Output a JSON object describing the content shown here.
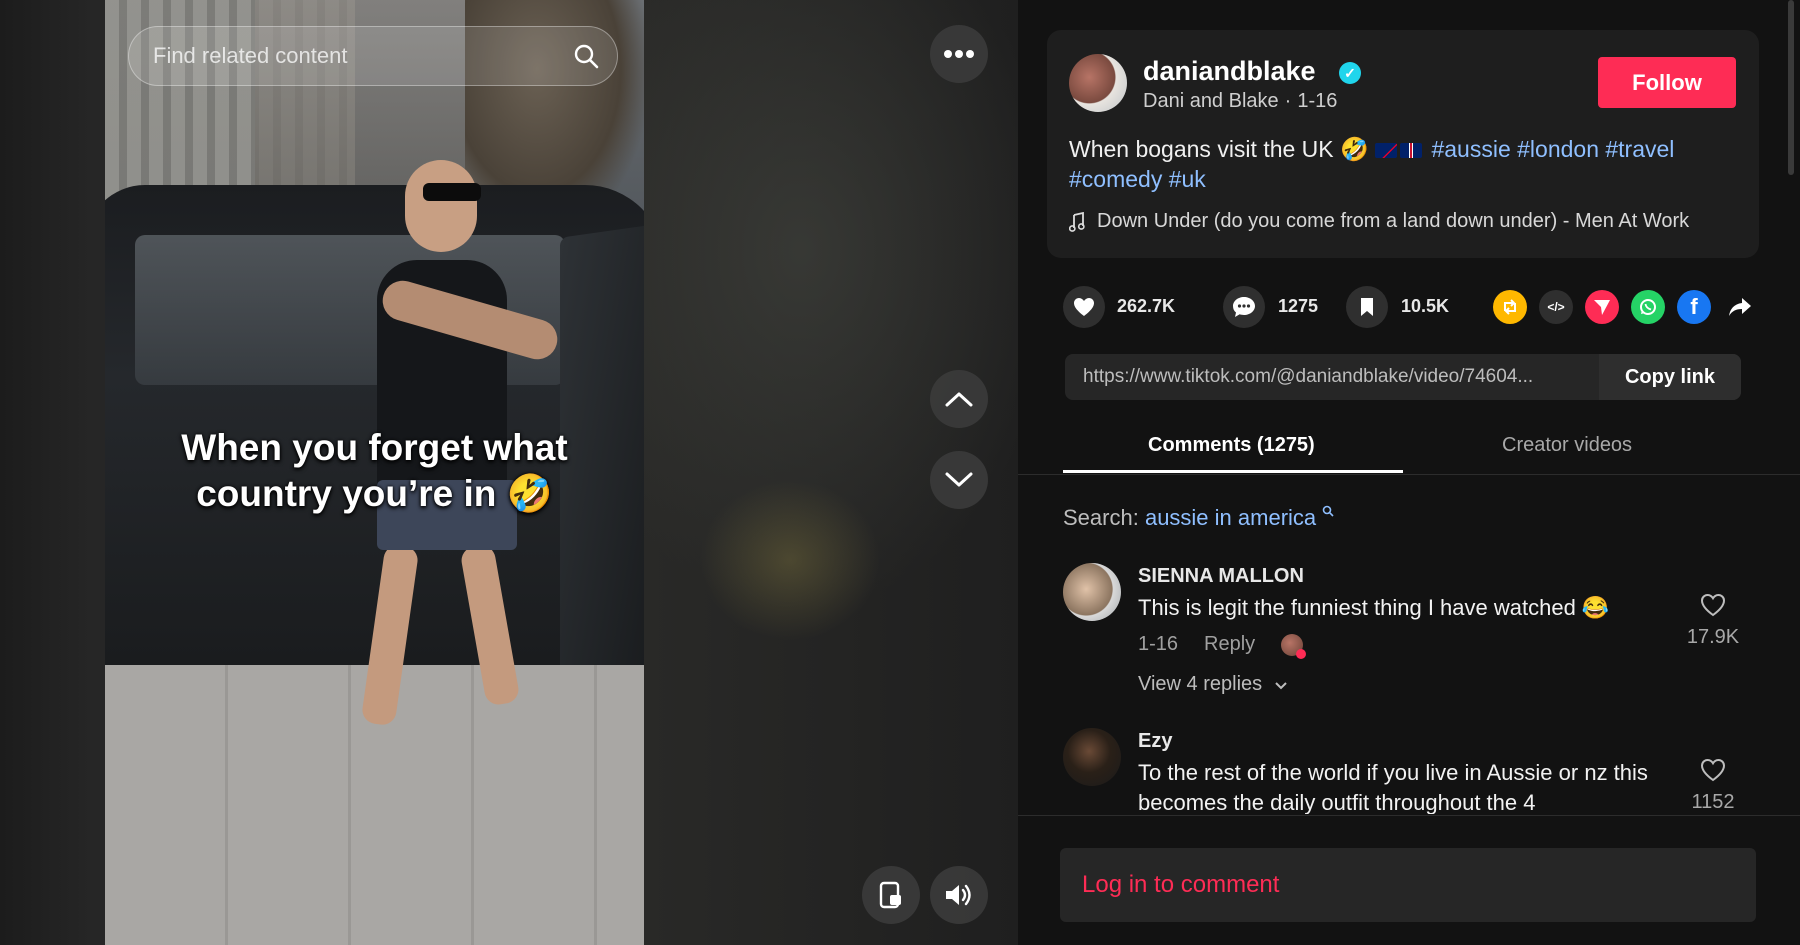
{
  "player": {
    "search_placeholder": "Find related content",
    "caption_line1": "When you forget what",
    "caption_line2": "country you’re in 🤣"
  },
  "post": {
    "username": "daniandblake",
    "display_name": "Dani and Blake",
    "separator": "·",
    "date": "1-16",
    "follow_label": "Follow",
    "description_text": "When bogans visit the UK 🤣",
    "hashtags": [
      "#aussie",
      "#london",
      "#travel",
      "#comedy",
      "#uk"
    ],
    "music": "Down Under (do you come from a land down under) - Men At Work"
  },
  "stats": {
    "likes": "262.7K",
    "comments": "1275",
    "saves": "10.5K"
  },
  "share": {
    "link": "https://www.tiktok.com/@daniandblake/video/74604...",
    "copy_label": "Copy link",
    "embed_symbol": "</>"
  },
  "tabs": {
    "comments": "Comments (1275)",
    "creator": "Creator videos"
  },
  "search": {
    "prefix": "Search:",
    "term": "aussie in america"
  },
  "comments": [
    {
      "name": "SIENNA MALLON",
      "text": "This is legit the funniest thing I have watched 😂",
      "date": "1-16",
      "reply": "Reply",
      "likes": "17.9K",
      "view_replies": "View 4 replies"
    },
    {
      "name": "Ezy",
      "text": "To the rest of the world if you live in Aussie or nz this becomes the daily outfit throughout the 4",
      "likes": "1152"
    }
  ],
  "login_prompt": "Log in to comment",
  "colors": {
    "accent": "#fe2c55",
    "hashtag": "#8fbfff",
    "verified": "#20d5ec",
    "repost": "#ffb800",
    "whatsapp": "#25d366",
    "facebook": "#1877f2"
  }
}
